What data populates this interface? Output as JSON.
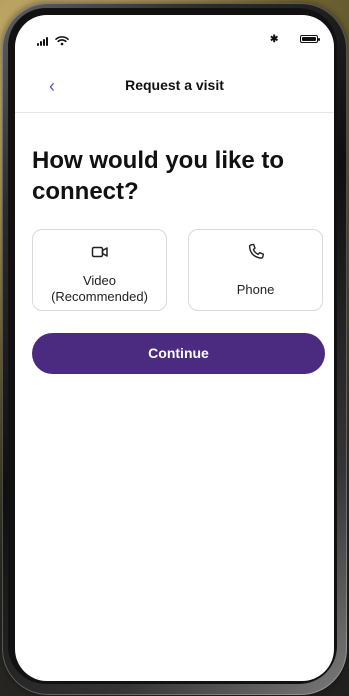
{
  "status_bar": {
    "signal_icon": "signal-icon",
    "wifi_icon": "wifi-icon",
    "bluetooth_icon": "bluetooth-icon",
    "battery_icon": "battery-icon"
  },
  "header": {
    "back_icon": "chevron-left-icon",
    "title": "Request a visit"
  },
  "main": {
    "heading": "How would you like to connect?",
    "options": [
      {
        "icon": "video-camera-icon",
        "label_line1": "Video",
        "label_line2": "(Recommended)"
      },
      {
        "icon": "phone-icon",
        "label": "Phone"
      }
    ],
    "continue_label": "Continue"
  },
  "colors": {
    "accent": "#4b2b7f",
    "link": "#5b4cc4"
  }
}
